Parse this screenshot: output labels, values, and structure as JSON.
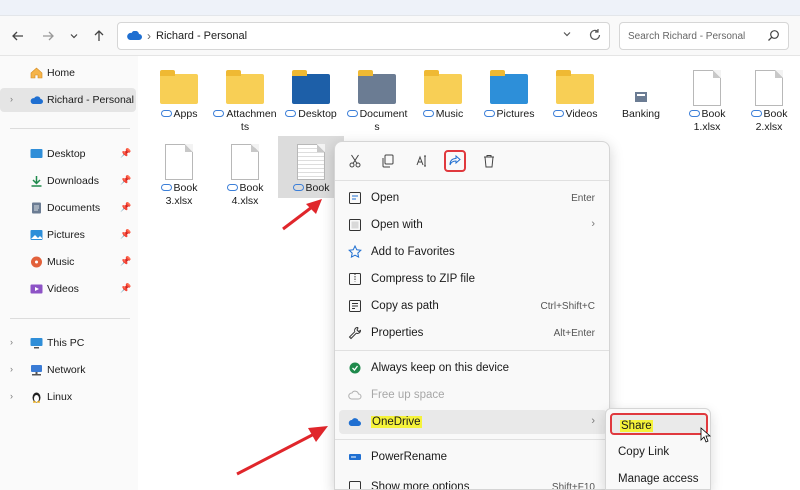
{
  "address": {
    "path": "Richard - Personal"
  },
  "search": {
    "placeholder": "Search Richard - Personal"
  },
  "sidebar": {
    "top": [
      {
        "label": "Home"
      },
      {
        "label": "Richard - Personal"
      }
    ],
    "pinned": [
      {
        "label": "Desktop"
      },
      {
        "label": "Downloads"
      },
      {
        "label": "Documents"
      },
      {
        "label": "Pictures"
      },
      {
        "label": "Music"
      },
      {
        "label": "Videos"
      }
    ],
    "drives": [
      {
        "label": "This PC"
      },
      {
        "label": "Network"
      },
      {
        "label": "Linux"
      }
    ]
  },
  "files": {
    "row1": [
      {
        "name": "Apps",
        "type": "folder"
      },
      {
        "name": "Attachments",
        "type": "folder"
      },
      {
        "name": "Desktop",
        "type": "folder-blue"
      },
      {
        "name": "Documents",
        "type": "folder-docs"
      },
      {
        "name": "Music",
        "type": "folder"
      },
      {
        "name": "Pictures",
        "type": "folder-pictures"
      },
      {
        "name": "Videos",
        "type": "folder"
      },
      {
        "name": "Banking",
        "type": "file"
      },
      {
        "name": "Book 1.xlsx",
        "type": "doc"
      },
      {
        "name": "Book 2.xlsx",
        "type": "doc"
      }
    ],
    "row2": [
      {
        "name": "Book 3.xlsx",
        "type": "doc"
      },
      {
        "name": "Book 4.xlsx",
        "type": "doc"
      },
      {
        "name": "Book",
        "type": "doc-selected"
      }
    ]
  },
  "context_menu": {
    "quick_actions": [
      "cut-icon",
      "copy-icon",
      "rename-icon",
      "share-icon",
      "delete-icon"
    ],
    "items": [
      {
        "label": "Open",
        "shortcut": "Enter"
      },
      {
        "label": "Open with",
        "shortcut": ""
      },
      {
        "label": "Add to Favorites",
        "shortcut": ""
      },
      {
        "label": "Compress to ZIP file",
        "shortcut": ""
      },
      {
        "label": "Copy as path",
        "shortcut": "Ctrl+Shift+C"
      },
      {
        "label": "Properties",
        "shortcut": "Alt+Enter"
      },
      {
        "label": "Always keep on this device",
        "shortcut": ""
      },
      {
        "label": "Free up space",
        "shortcut": ""
      },
      {
        "label": "OneDrive",
        "shortcut": ""
      },
      {
        "label": "PowerRename",
        "shortcut": ""
      },
      {
        "label": "Show more options",
        "shortcut": "Shift+F10"
      }
    ]
  },
  "submenu": {
    "items": [
      {
        "label": "Share"
      },
      {
        "label": "Copy Link"
      },
      {
        "label": "Manage access"
      }
    ]
  },
  "colors": {
    "accent": "#3c7fd8",
    "highlight_box": "#e0393e",
    "text_highlight": "#f5f33a",
    "arrow": "#e0262b"
  }
}
